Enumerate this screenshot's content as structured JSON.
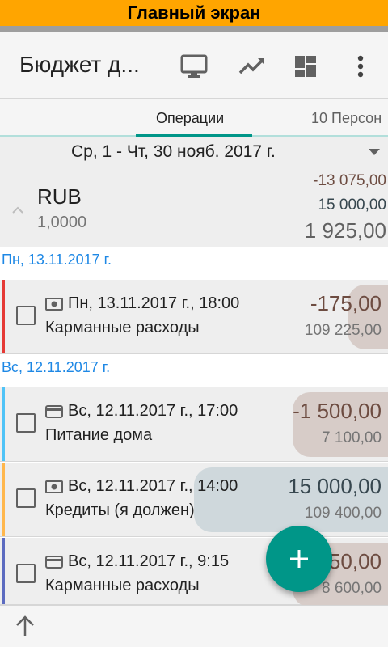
{
  "banner": {
    "text": "Главный экран"
  },
  "appbar": {
    "title": "Бюджет д...",
    "icons": [
      "monitor-icon",
      "trending-up-icon",
      "dashboard-icon",
      "more-vert-icon"
    ]
  },
  "tabs": [
    {
      "label": "Операции",
      "active": true
    },
    {
      "label": "10 Персон",
      "active": false
    }
  ],
  "period": {
    "label": "Ср, 1 - Чт, 30 нояб. 2017 г."
  },
  "summary": {
    "currency": "RUB",
    "rate": "1,0000",
    "expenses": "-13 075,00",
    "income": "15 000,00",
    "total": "1 925,00"
  },
  "days": [
    {
      "header": "Пн, 13.11.2017 г."
    },
    {
      "header": "Вс, 12.11.2017 г."
    }
  ],
  "transactions": [
    {
      "datetime": "Пн, 13.11.2017 г., 18:00",
      "category": "Карманные расходы",
      "amount": "-175,00",
      "balance": "109 225,00",
      "icon": "cash-icon",
      "bar_color": "#e53935",
      "amount_color": "#6d4c41",
      "bg_color": "#d7ccc8"
    },
    {
      "datetime": "Вс, 12.11.2017 г., 17:00",
      "category": "Питание дома",
      "amount": "-1 500,00",
      "balance": "7 100,00",
      "icon": "card-icon",
      "bar_color": "#4fc3f7",
      "amount_color": "#6d4c41",
      "bg_color": "#d7ccc8"
    },
    {
      "datetime": "Вс, 12.11.2017 г., 14:00",
      "category": "Кредиты (я должен)",
      "amount": "15 000,00",
      "balance": "109 400,00",
      "icon": "cash-icon",
      "bar_color": "#ffb74d",
      "amount_color": "#37474f",
      "bg_color": "#cfd8dc"
    },
    {
      "datetime": "Вс, 12.11.2017 г., 9:15",
      "category": "Карманные расходы",
      "amount": "-1 550,00",
      "balance": "8 600,00",
      "icon": "card-icon",
      "bar_color": "#5c6bc0",
      "amount_color": "#6d4c41",
      "bg_color": "#d7ccc8"
    }
  ],
  "fab": {
    "icon": "plus-icon"
  },
  "colors": {
    "accent": "#009688",
    "banner": "#ffa500",
    "link": "#1e88e5"
  }
}
